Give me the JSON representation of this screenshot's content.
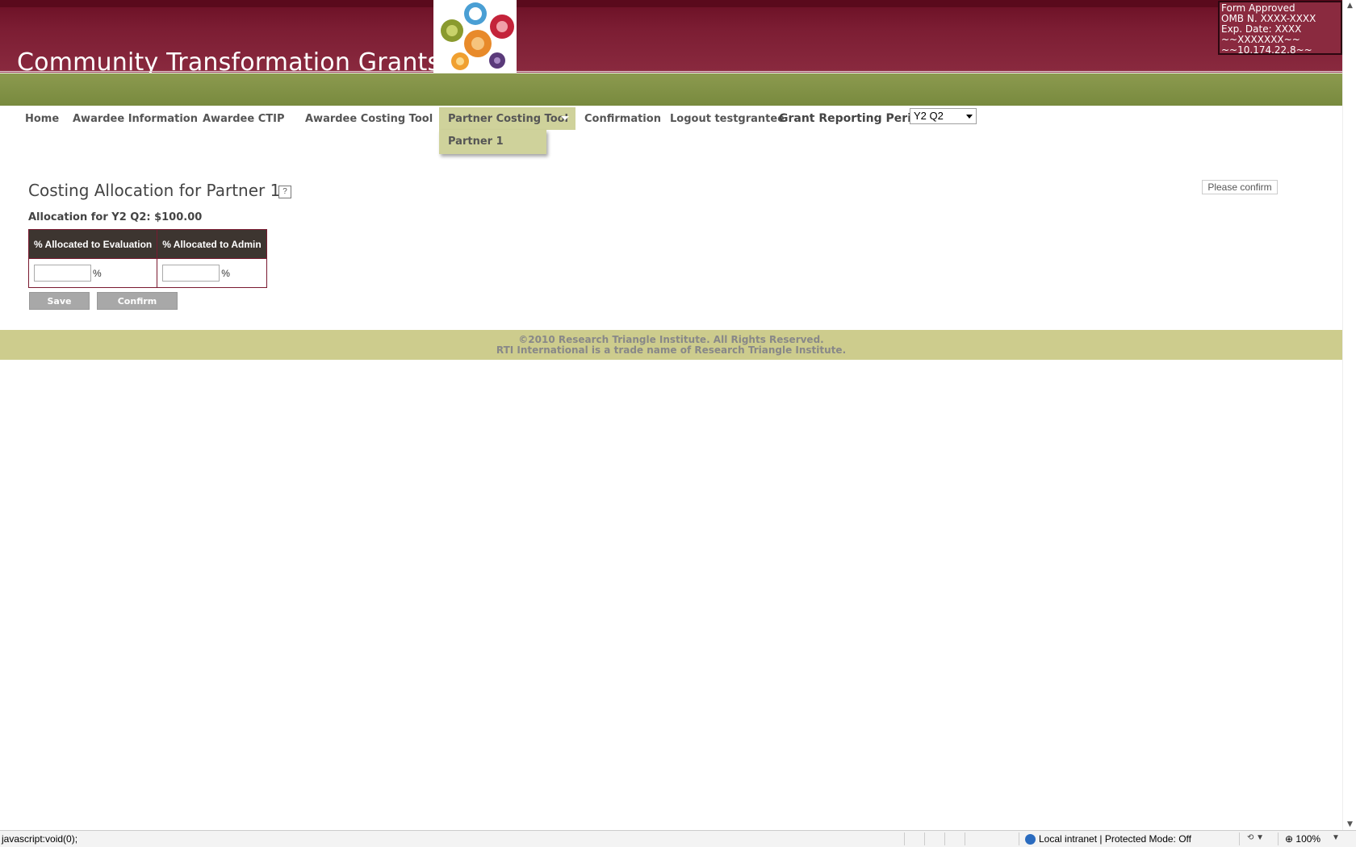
{
  "header": {
    "title": "Community Transformation Grants",
    "form_info": [
      "Form Approved",
      "OMB N. XXXX-XXXX",
      "Exp. Date: XXXX",
      "~~XXXXXXX~~",
      "~~10.174.22.8~~"
    ]
  },
  "nav": {
    "items": [
      "Home",
      "Awardee Information",
      "Awardee CTIP",
      "Awardee Costing Tool",
      "Partner Costing Tool",
      "Confirmation",
      "Logout testgrantee"
    ],
    "active": "Partner Costing Tool",
    "dropdown_items": [
      "Partner 1"
    ],
    "period_label": "Grant Reporting Period:",
    "period_value": "Y2 Q2"
  },
  "main": {
    "heading": "Costing Allocation for Partner 1",
    "help_label": "?",
    "please_confirm": "Please confirm",
    "allocation_line": "Allocation for Y2 Q2: $100.00",
    "table": {
      "headers": [
        "% Allocated to Evaluation",
        "% Allocated to Admin"
      ],
      "values": [
        "",
        ""
      ],
      "unit": "%"
    },
    "buttons": {
      "save": "Save",
      "confirm": "Confirm"
    }
  },
  "footer": {
    "line1": "©2010 Research Triangle Institute. All Rights Reserved.",
    "line2": "RTI International is a trade name of Research Triangle Institute."
  },
  "statusbar": {
    "left": "javascript:void(0);",
    "zone": "Local intranet | Protected Mode: Off",
    "zoom": "100%"
  },
  "colors": {
    "header": "#7c1d33",
    "green_band": "#7f8e45",
    "nav_active": "#cfd29b",
    "footer": "#cdcc8d",
    "table_header": "#3d3530",
    "button": "#a8a8a8"
  }
}
